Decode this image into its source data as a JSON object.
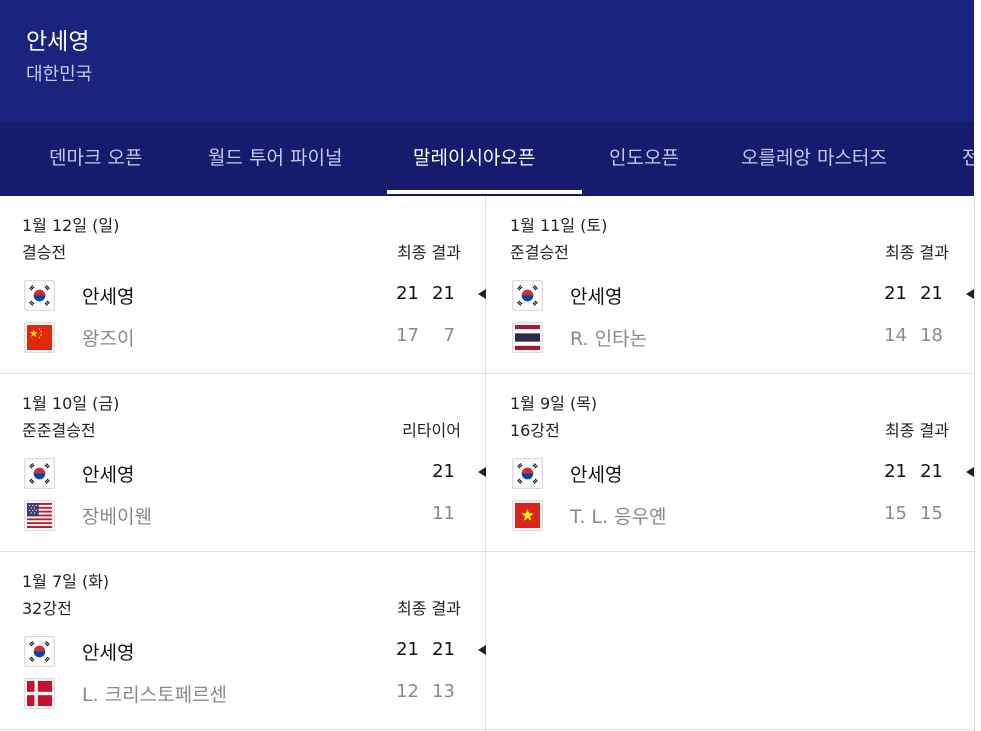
{
  "player": {
    "name": "안세영",
    "country": "대한민국"
  },
  "tabs": [
    {
      "label": "덴마크 오픈"
    },
    {
      "label": "월드 투어 파이널"
    },
    {
      "label": "말레이시아오픈"
    },
    {
      "label": "인도오픈"
    },
    {
      "label": "오를레앙 마스터즈"
    },
    {
      "label": "전"
    }
  ],
  "active_tab": "말레이시아오픈",
  "matches": [
    {
      "date": "1월 12일 (일)",
      "round": "결승전",
      "status": "최종 결과",
      "winner": {
        "name": "안세영",
        "flag": "korea-flag-icon",
        "scores": [
          "21",
          "21"
        ]
      },
      "loser": {
        "name": "왕즈이",
        "flag": "china-flag-icon",
        "scores": [
          "17",
          "7"
        ]
      }
    },
    {
      "date": "1월 11일 (토)",
      "round": "준결승전",
      "status": "최종 결과",
      "winner": {
        "name": "안세영",
        "flag": "korea-flag-icon",
        "scores": [
          "21",
          "21"
        ]
      },
      "loser": {
        "name": "R. 인타논",
        "flag": "thailand-flag-icon",
        "scores": [
          "14",
          "18"
        ]
      }
    },
    {
      "date": "1월 10일 (금)",
      "round": "준준결승전",
      "status": "리타이어",
      "winner": {
        "name": "안세영",
        "flag": "korea-flag-icon",
        "scores": [
          "",
          "21"
        ]
      },
      "loser": {
        "name": "장베이웬",
        "flag": "usa-flag-icon",
        "scores": [
          "",
          "11"
        ]
      }
    },
    {
      "date": "1월 9일 (목)",
      "round": "16강전",
      "status": "최종 결과",
      "winner": {
        "name": "안세영",
        "flag": "korea-flag-icon",
        "scores": [
          "21",
          "21"
        ]
      },
      "loser": {
        "name": "T. L. 응우옌",
        "flag": "vietnam-flag-icon",
        "scores": [
          "15",
          "15"
        ]
      }
    },
    {
      "date": "1월 7일 (화)",
      "round": "32강전",
      "status": "최종 결과",
      "winner": {
        "name": "안세영",
        "flag": "korea-flag-icon",
        "scores": [
          "21",
          "21"
        ]
      },
      "loser": {
        "name": "L. 크리스토페르센",
        "flag": "denmark-flag-icon",
        "scores": [
          "12",
          "13"
        ]
      }
    }
  ],
  "colors": {
    "header_bg": "#1a237e",
    "tabs_bg": "#151c6e",
    "winner_text": "#111111",
    "loser_text": "#8a8a8a",
    "divider": "#e0e0e0"
  }
}
